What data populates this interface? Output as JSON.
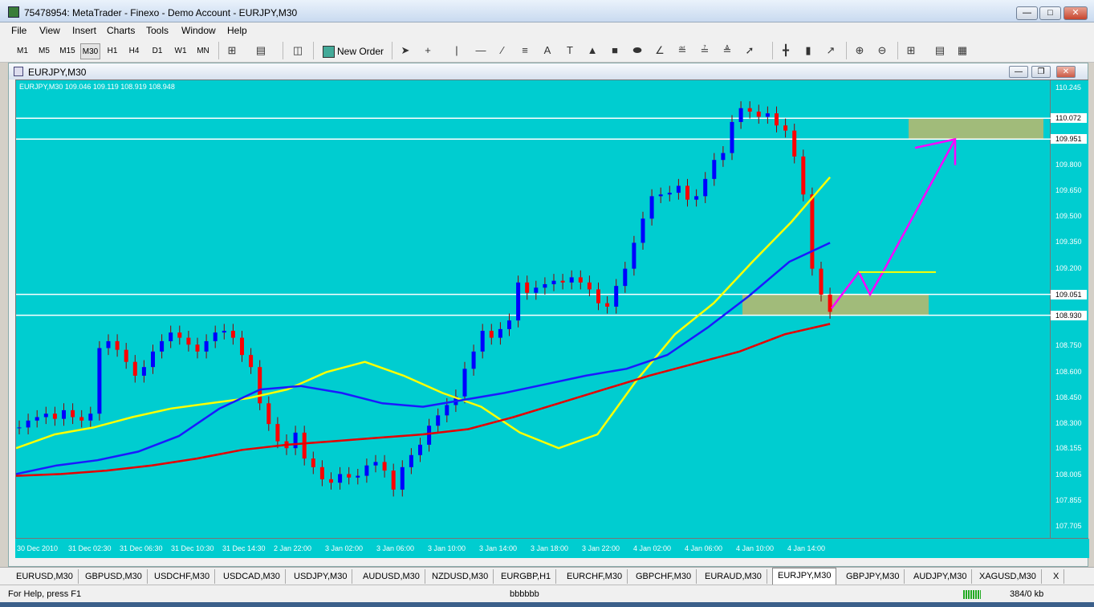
{
  "window": {
    "title": "75478954: MetaTrader - Finexo - Demo Account - EURJPY,M30"
  },
  "menu": [
    "File",
    "View",
    "Insert",
    "Charts",
    "Tools",
    "Window",
    "Help"
  ],
  "timeframes": [
    "M1",
    "M5",
    "M15",
    "M30",
    "H1",
    "H4",
    "D1",
    "W1",
    "MN"
  ],
  "selected_timeframe": "M30",
  "toolbar": {
    "new_order_label": "New Order"
  },
  "chart_window": {
    "title": "EURJPY,M30",
    "info": "EURJPY,M30  109.046 109.119 108.919 108.948"
  },
  "price_scale": {
    "labels": [
      "110.245",
      "109.800",
      "109.650",
      "109.500",
      "109.350",
      "109.200",
      "108.750",
      "108.600",
      "108.450",
      "108.300",
      "108.155",
      "108.005",
      "107.855",
      "107.705"
    ],
    "boxes": [
      "110.072",
      "109.951",
      "109.051",
      "108.930"
    ]
  },
  "time_labels": [
    "30 Dec 2010",
    "31 Dec 02:30",
    "31 Dec 06:30",
    "31 Dec 10:30",
    "31 Dec 14:30",
    "2 Jan 22:00",
    "3 Jan 02:00",
    "3 Jan 06:00",
    "3 Jan 10:00",
    "3 Jan 14:00",
    "3 Jan 18:00",
    "3 Jan 22:00",
    "4 Jan 02:00",
    "4 Jan 06:00",
    "4 Jan 10:00",
    "4 Jan 14:00"
  ],
  "tabs": [
    "EURUSD,M30",
    "GBPUSD,M30",
    "USDCHF,M30",
    "USDCAD,M30",
    "USDJPY,M30",
    "AUDUSD,M30",
    "NZDUSD,M30",
    "EURGBP,H1",
    "EURCHF,M30",
    "GBPCHF,M30",
    "EURAUD,M30",
    "EURJPY,M30",
    "GBPJPY,M30",
    "AUDJPY,M30",
    "XAGUSD,M30",
    "X"
  ],
  "active_tab": "EURJPY,M30",
  "status": {
    "help": "For Help, press F1",
    "profile": "bbbbbb",
    "traffic": "384/0 kb"
  },
  "chart_data": {
    "type": "candlestick",
    "symbol": "EURJPY",
    "timeframe": "M30",
    "ylim": [
      107.705,
      110.245
    ],
    "horizontal_levels": [
      110.072,
      109.951,
      109.051,
      108.93
    ],
    "zones": [
      {
        "from": 109.951,
        "to": 110.072,
        "color": "#bdb76b"
      },
      {
        "from": 108.93,
        "to": 109.051,
        "color": "#bdb76b"
      }
    ],
    "moving_averages": [
      {
        "color": "#ffff00",
        "values": [
          108.16,
          108.24,
          108.28,
          108.34,
          108.39,
          108.42,
          108.45,
          108.5,
          108.6,
          108.66,
          108.58,
          108.48,
          108.4,
          108.25,
          108.16,
          108.24,
          108.55,
          108.82,
          109.0,
          109.24,
          109.47,
          109.73
        ]
      },
      {
        "color": "#1a1aff",
        "values": [
          108.01,
          108.06,
          108.09,
          108.14,
          108.23,
          108.39,
          108.5,
          108.52,
          108.48,
          108.42,
          108.4,
          108.44,
          108.48,
          108.53,
          108.58,
          108.62,
          108.7,
          108.86,
          109.04,
          109.24,
          109.35
        ]
      },
      {
        "color": "#e60000",
        "values": [
          108.0,
          108.01,
          108.03,
          108.06,
          108.1,
          108.15,
          108.18,
          108.2,
          108.22,
          108.24,
          108.27,
          108.34,
          108.42,
          108.5,
          108.58,
          108.65,
          108.72,
          108.82,
          108.88
        ]
      }
    ],
    "candles": [
      108.28,
      108.32,
      108.34,
      108.36,
      108.33,
      108.38,
      108.34,
      108.32,
      108.36,
      108.74,
      108.78,
      108.73,
      108.66,
      108.58,
      108.63,
      108.72,
      108.78,
      108.83,
      108.8,
      108.76,
      108.72,
      108.78,
      108.83,
      108.84,
      108.8,
      108.7,
      108.63,
      108.42,
      108.3,
      108.2,
      108.16,
      108.25,
      108.1,
      108.05,
      107.98,
      107.96,
      108.01,
      107.99,
      108.0,
      108.06,
      108.08,
      108.03,
      107.92,
      108.05,
      108.12,
      108.18,
      108.29,
      108.35,
      108.41,
      108.46,
      108.62,
      108.72,
      108.84,
      108.8,
      108.85,
      108.9,
      109.12,
      109.06,
      109.09,
      109.11,
      109.13,
      109.12,
      109.15,
      109.12,
      109.08,
      109.0,
      108.98,
      109.1,
      109.2,
      109.35,
      109.49,
      109.62,
      109.63,
      109.64,
      109.68,
      109.6,
      109.62,
      109.72,
      109.83,
      109.87,
      110.05,
      110.13,
      110.11,
      110.08,
      110.1,
      110.03,
      110.0,
      109.85,
      109.63,
      109.2,
      109.05,
      108.95
    ]
  }
}
